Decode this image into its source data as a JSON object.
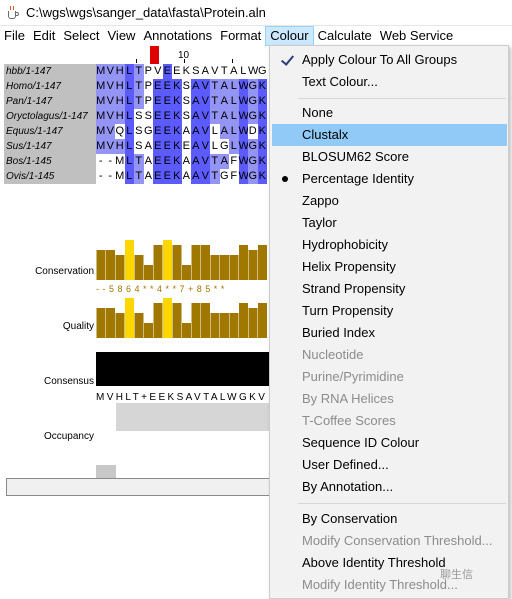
{
  "window": {
    "title": "C:\\wgs\\wgs\\sanger_data\\fasta\\Protein.aln"
  },
  "menubar": [
    "File",
    "Edit",
    "Select",
    "View",
    "Annotations",
    "Format",
    "Colour",
    "Calculate",
    "Web Service"
  ],
  "ruler": {
    "label_10": "10"
  },
  "sequences": [
    {
      "name": "hbb/1-147",
      "seq": "MVHLTPVEEKSAVTALWGKV"
    },
    {
      "name": "Homo/1-147",
      "seq": "MVHLTPEEKSAVTALWGKV"
    },
    {
      "name": "Pan/1-147",
      "seq": "MVHLTPEEKSAVTALWGKV"
    },
    {
      "name": "Oryctolagus/1-147",
      "seq": "MVHLSSEEKSAVTALWGKV"
    },
    {
      "name": "Equus/1-147",
      "seq": "MVQLSGEEKAAVLALWDKV"
    },
    {
      "name": "Sus/1-147",
      "seq": "MVHLSAEEKEAVLGLWGKV"
    },
    {
      "name": "Bos/1-145",
      "seq": "--MLTAEEKAAVTAFWGKV"
    },
    {
      "name": "Ovis/1-145",
      "seq": "--MLTAEEKAAVTGFWGKV"
    }
  ],
  "annotations": {
    "conservation_label": "Conservation",
    "conservation_values": "- - 5 8 6 4 * * 4 * * 7 + 8 5 * *",
    "quality_label": "Quality",
    "consensus_label": "Consensus",
    "consensus_seq": "MVHLT+EEKSAVTALWGKV",
    "occupancy_label": "Occupancy"
  },
  "colour_menu": {
    "items": [
      {
        "label": "Apply Colour To All Groups",
        "state": "checked"
      },
      {
        "label": "Text Colour...",
        "state": "normal"
      },
      {
        "label": "None",
        "state": "normal"
      },
      {
        "label": "Clustalx",
        "state": "highlighted"
      },
      {
        "label": "BLOSUM62 Score",
        "state": "normal"
      },
      {
        "label": "Percentage Identity",
        "state": "selected"
      },
      {
        "label": "Zappo",
        "state": "normal"
      },
      {
        "label": "Taylor",
        "state": "normal"
      },
      {
        "label": "Hydrophobicity",
        "state": "normal"
      },
      {
        "label": "Helix Propensity",
        "state": "normal"
      },
      {
        "label": "Strand Propensity",
        "state": "normal"
      },
      {
        "label": "Turn Propensity",
        "state": "normal"
      },
      {
        "label": "Buried Index",
        "state": "normal"
      },
      {
        "label": "Nucleotide",
        "state": "disabled"
      },
      {
        "label": "Purine/Pyrimidine",
        "state": "disabled"
      },
      {
        "label": "By RNA Helices",
        "state": "disabled"
      },
      {
        "label": "T-Coffee Scores",
        "state": "disabled"
      },
      {
        "label": "Sequence ID Colour",
        "state": "normal"
      },
      {
        "label": "User Defined...",
        "state": "normal"
      },
      {
        "label": "By Annotation...",
        "state": "normal"
      },
      {
        "label": "By Conservation",
        "state": "normal"
      },
      {
        "label": "Modify Conservation Threshold...",
        "state": "disabled"
      },
      {
        "label": "Above Identity Threshold",
        "state": "normal"
      },
      {
        "label": "Modify Identity Threshold...",
        "state": "disabled"
      }
    ]
  },
  "watermark": "聊生信",
  "colors": {
    "dark": "#5b5bff",
    "mid": "#9494f5",
    "light": "#cbcbff",
    "highlight": "#91c9f7",
    "accent_red": "#e00000",
    "bar_yellow": "#ffd700",
    "bar_olive": "#a07800"
  }
}
